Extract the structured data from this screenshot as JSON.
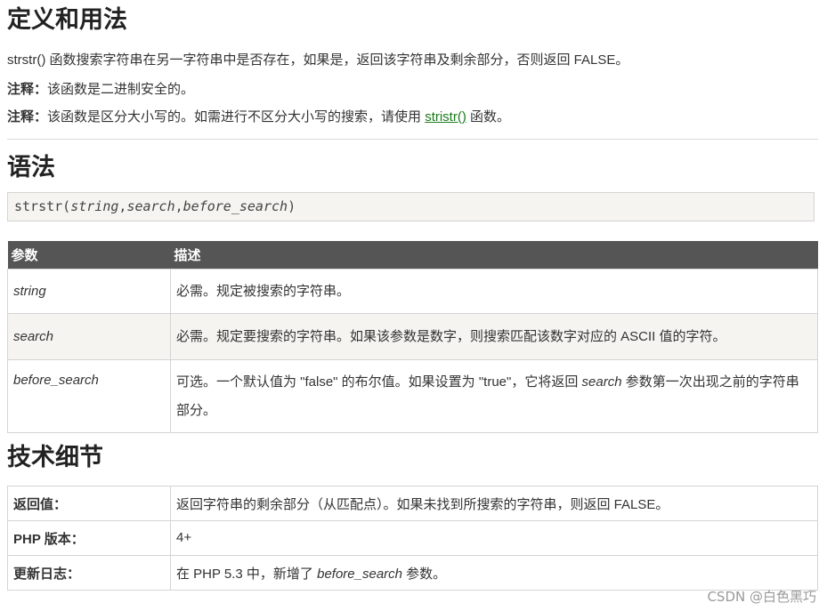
{
  "section_def": {
    "title": "定义和用法",
    "para1": "strstr() 函数搜索字符串在另一字符串中是否存在，如果是，返回该字符串及剩余部分，否则返回 FALSE。",
    "note1_label": "注释：",
    "note1_text": "该函数是二进制安全的。",
    "note2_label": "注释：",
    "note2_text_before": "该函数是区分大小写的。如需进行不区分大小写的搜索，请使用 ",
    "note2_link": "stristr()",
    "note2_text_after": " 函数。"
  },
  "section_syntax": {
    "title": "语法",
    "fn": "strstr(",
    "arg1": "string",
    "sep1": ",",
    "arg2": "search",
    "sep2": ",",
    "arg3": "before_search",
    "close": ")"
  },
  "params_table": {
    "headers": [
      "参数",
      "描述"
    ],
    "rows": [
      {
        "name": "string",
        "desc": "必需。规定被搜索的字符串。"
      },
      {
        "name": "search",
        "desc": "必需。规定要搜索的字符串。如果该参数是数字，则搜索匹配该数字对应的 ASCII 值的字符。"
      },
      {
        "name": "before_search",
        "desc_before": "可选。一个默认值为 \"false\" 的布尔值。如果设置为 \"true\"，它将返回 ",
        "desc_em": "search",
        "desc_after": " 参数第一次出现之前的字符串部分。"
      }
    ]
  },
  "section_tech": {
    "title": "技术细节",
    "rows": [
      {
        "key": "返回值：",
        "value": "返回字符串的剩余部分（从匹配点）。如果未找到所搜索的字符串，则返回 FALSE。"
      },
      {
        "key": "PHP 版本：",
        "value": "4+"
      },
      {
        "key": "更新日志：",
        "value_before": "在 PHP 5.3 中，新增了 ",
        "value_em": "before_search",
        "value_after": " 参数。"
      }
    ]
  },
  "watermark": "CSDN @白色黑巧"
}
